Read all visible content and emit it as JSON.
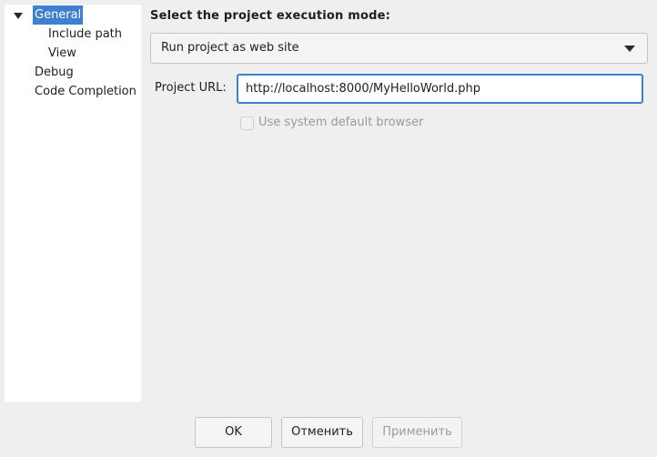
{
  "tree": {
    "items": [
      {
        "label": "General",
        "selected": true,
        "expanded": true
      },
      {
        "label": "Include path"
      },
      {
        "label": "View"
      },
      {
        "label": "Debug"
      },
      {
        "label": "Code Completion"
      }
    ]
  },
  "main": {
    "section_title": "Select the project execution mode:",
    "mode_select": {
      "value": "Run project as web site"
    },
    "url_label": "Project URL:",
    "url_value": "http://localhost:8000/MyHelloWorld.php",
    "browser_checkbox": {
      "label": "Use system default browser",
      "checked": false,
      "disabled": true
    }
  },
  "buttons": {
    "ok": "OK",
    "cancel": "Отменить",
    "apply": "Применить"
  },
  "colors": {
    "selection": "#3d80cf",
    "window_bg": "#efefef",
    "disabled_text": "#9a9a9a"
  }
}
